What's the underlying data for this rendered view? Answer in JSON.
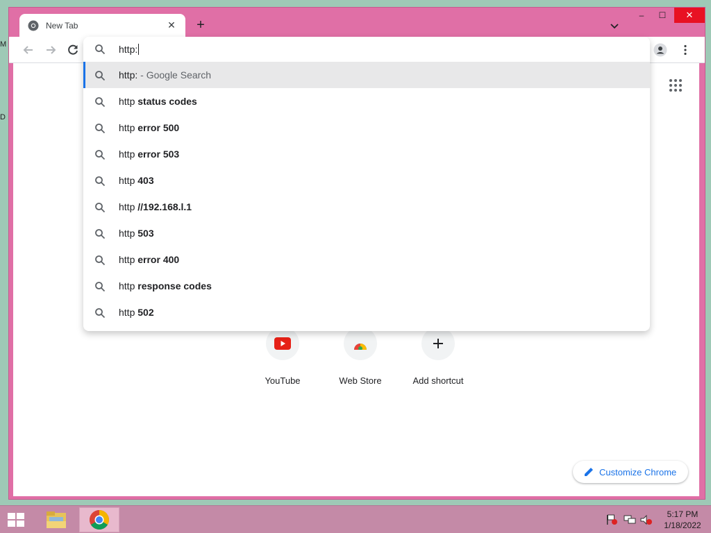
{
  "desktop": {
    "frag_1": "M",
    "frag_2": "D"
  },
  "window": {
    "tab": {
      "title": "New Tab"
    },
    "new_tab_symbol": "+",
    "controls": {
      "minimize": "‒",
      "maximize": "☐",
      "close": "✕"
    }
  },
  "omnibox": {
    "value": "http:",
    "suggestions": [
      {
        "prefix": "http:",
        "bold": "",
        "suffix": " - Google Search",
        "selected": true
      },
      {
        "prefix": "http ",
        "bold": "status codes",
        "suffix": ""
      },
      {
        "prefix": "http ",
        "bold": "error 500",
        "suffix": ""
      },
      {
        "prefix": "http ",
        "bold": "error 503",
        "suffix": ""
      },
      {
        "prefix": "http ",
        "bold": "403",
        "suffix": ""
      },
      {
        "prefix": "http ",
        "bold": "//192.168.l.1",
        "suffix": ""
      },
      {
        "prefix": "http ",
        "bold": "503",
        "suffix": ""
      },
      {
        "prefix": "http ",
        "bold": "error 400",
        "suffix": ""
      },
      {
        "prefix": "http ",
        "bold": "response codes",
        "suffix": ""
      },
      {
        "prefix": "http ",
        "bold": "502",
        "suffix": ""
      }
    ]
  },
  "shortcuts": [
    {
      "label": "YouTube",
      "icon": "youtube-icon"
    },
    {
      "label": "Web Store",
      "icon": "webstore-icon"
    },
    {
      "label": "Add shortcut",
      "icon": "plus-icon"
    }
  ],
  "customize": {
    "label": "Customize Chrome"
  },
  "taskbar": {
    "time": "5:17 PM",
    "date": "1/18/2022"
  },
  "colors": {
    "window_frame": "#e06fa6",
    "accent": "#1a73e8",
    "taskbar": "#c48aa7",
    "close_red": "#e81123"
  }
}
